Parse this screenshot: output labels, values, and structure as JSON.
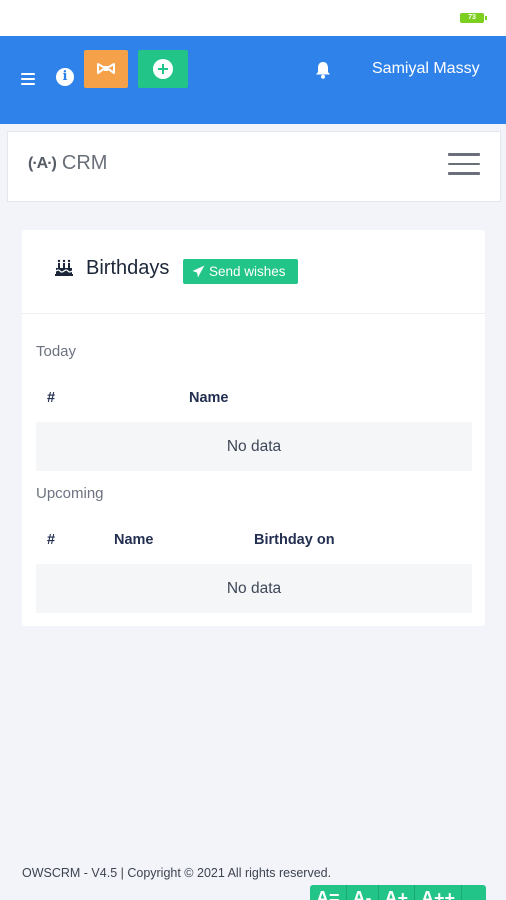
{
  "status": {
    "battery": "73"
  },
  "topbar": {
    "user_name": "Samiyal Massy",
    "icons": [
      "menu-icon",
      "info-icon",
      "ribbon-icon",
      "plus-circle-icon",
      "bell-icon"
    ],
    "info_glyph": "i",
    "colors": {
      "bar": "#2f82ea",
      "orange": "#f5a14a",
      "green": "#22c487"
    }
  },
  "crm_bar": {
    "logo_glyph": "(·A·)",
    "title": "CRM"
  },
  "birthdays": {
    "title": "Birthdays",
    "send_wishes": "Send wishes",
    "today": {
      "label": "Today",
      "headers": [
        "#",
        "Name"
      ],
      "empty": "No data"
    },
    "upcoming": {
      "label": "Upcoming",
      "headers": [
        "#",
        "Name",
        "Birthday on"
      ],
      "empty": "No data"
    }
  },
  "footer": {
    "copyright": "OWSCRM - V4.5 | Copyright © 2021 All rights reserved.",
    "font_controls": [
      "A=",
      "A-",
      "A+",
      "A++"
    ]
  }
}
